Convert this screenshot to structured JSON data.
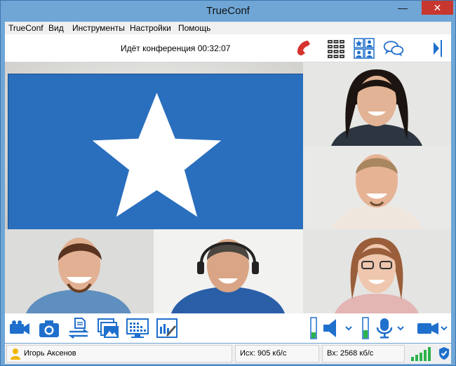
{
  "window": {
    "title": "TrueConf",
    "minimize_glyph": "—",
    "maximize_glyph": "☐",
    "close_glyph": "✕"
  },
  "menu": [
    {
      "label": "TrueConf"
    },
    {
      "label": "Вид"
    },
    {
      "label": "Инструменты"
    },
    {
      "label": "Настройки"
    },
    {
      "label": "Помощь"
    }
  ],
  "toolbar": {
    "status_text": "Идёт конференция 00:32:07",
    "icons": [
      "hangup-phone-icon",
      "dialpad-icon",
      "layout-grid-icon",
      "chat-icon",
      "panel-toggle-icon"
    ]
  },
  "participants": [
    {
      "id": "main",
      "icon": "star-icon"
    },
    {
      "id": "p2"
    },
    {
      "id": "p3"
    },
    {
      "id": "p4"
    },
    {
      "id": "p5"
    },
    {
      "id": "p6"
    }
  ],
  "controls": {
    "icons": [
      "camera-icon",
      "snapshot-icon",
      "file-transfer-icon",
      "slideshow-icon",
      "screen-share-icon",
      "whiteboard-icon",
      "speaker-icon",
      "microphone-icon",
      "video-device-icon"
    ],
    "speaker_level": 0.3,
    "mic_level": 0.4
  },
  "status": {
    "user_name": "Игорь Аксенов",
    "outgoing": "Исх: 905 кб/с",
    "incoming": "Вх: 2568 кб/с",
    "signal_bars": 5
  },
  "colors": {
    "accent": "#1f6fcc",
    "hangup": "#d6322e",
    "level_green": "#2bb34a",
    "window_frame": "#6fa6d6"
  }
}
